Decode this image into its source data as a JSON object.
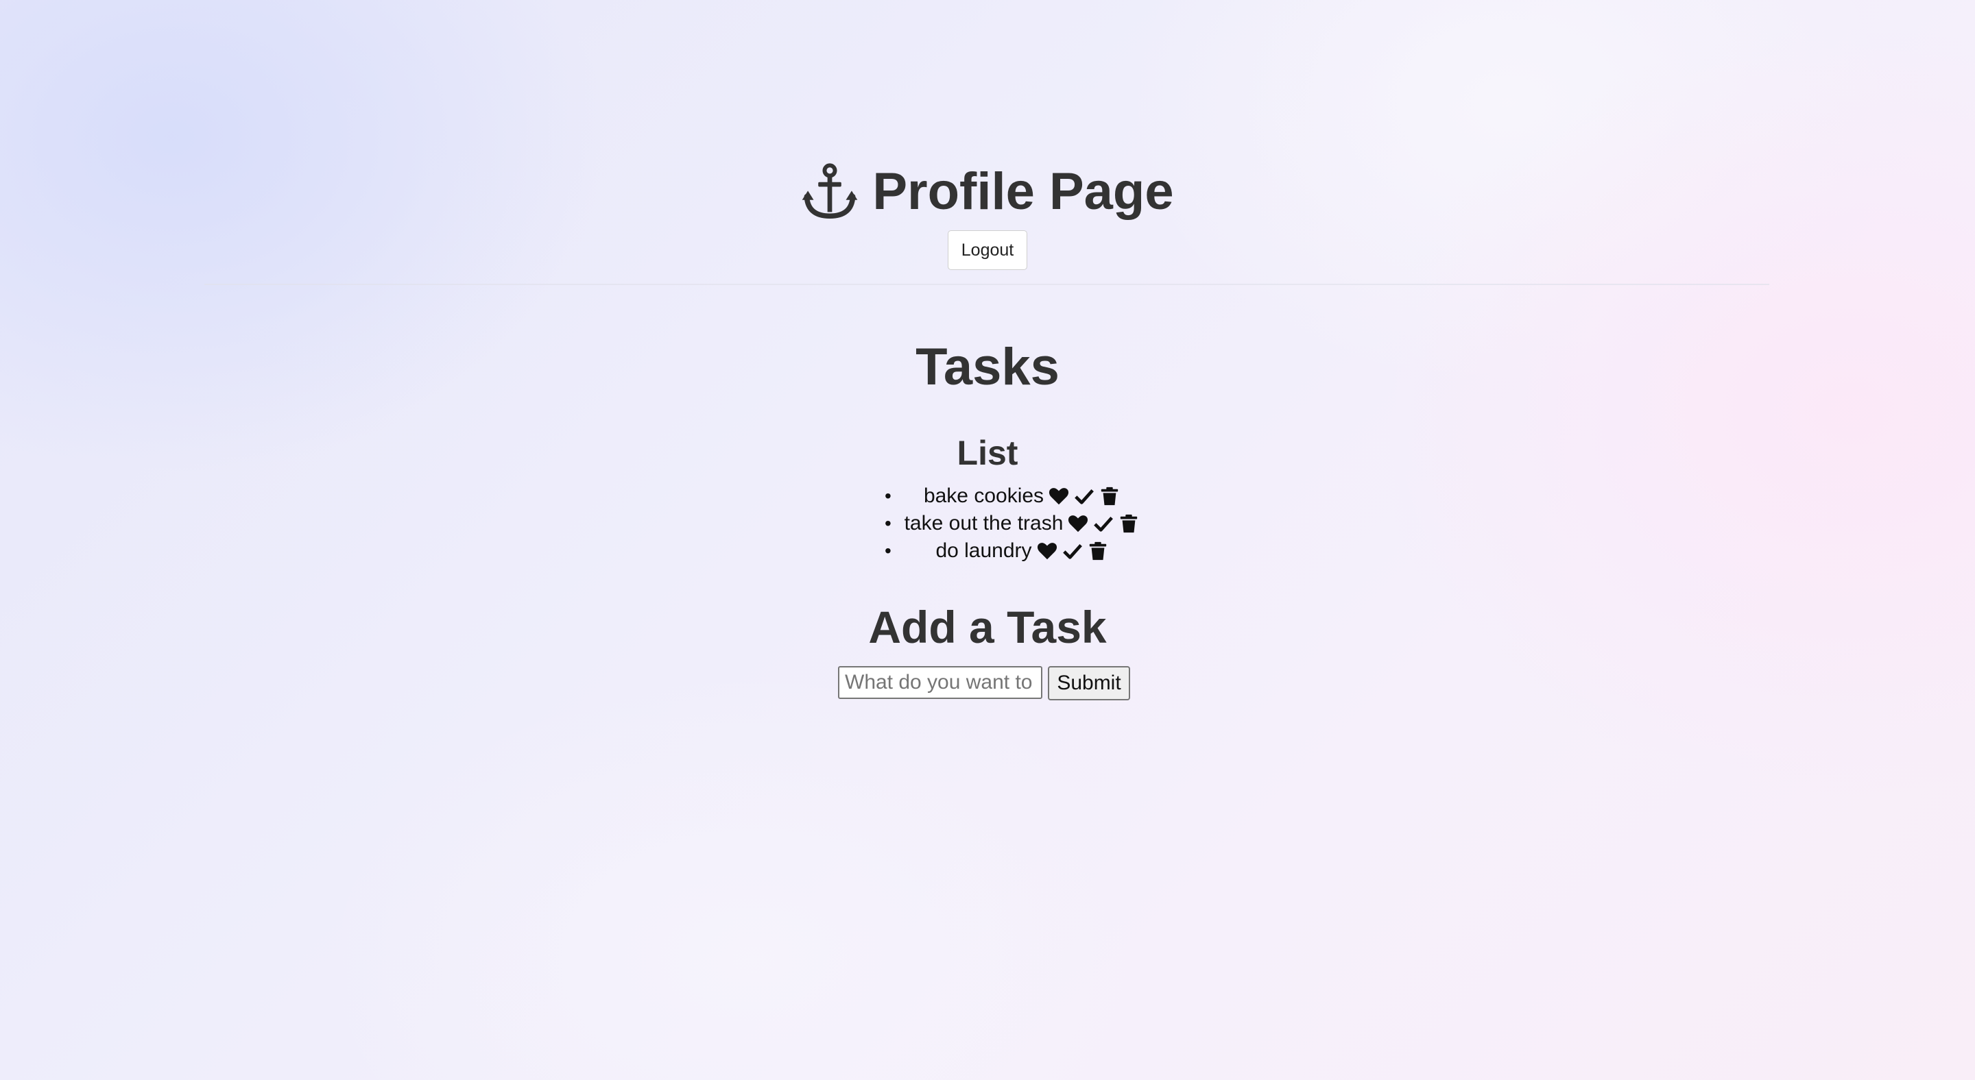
{
  "header": {
    "title": "Profile Page",
    "icon": "anchor-icon",
    "logout_label": "Logout"
  },
  "tasks": {
    "title": "Tasks",
    "list_title": "List",
    "items": [
      {
        "label": "bake cookies",
        "icons": [
          "heart-icon",
          "check-icon",
          "trash-icon"
        ]
      },
      {
        "label": "take out the trash",
        "icons": [
          "heart-icon",
          "check-icon",
          "trash-icon"
        ]
      },
      {
        "label": "do laundry",
        "icons": [
          "heart-icon",
          "check-icon",
          "trash-icon"
        ]
      }
    ]
  },
  "add_task": {
    "title": "Add a Task",
    "input_placeholder": "What do you want to add?",
    "input_value": "",
    "submit_label": "Submit"
  },
  "colors": {
    "text": "#333333",
    "icon": "#111111"
  }
}
